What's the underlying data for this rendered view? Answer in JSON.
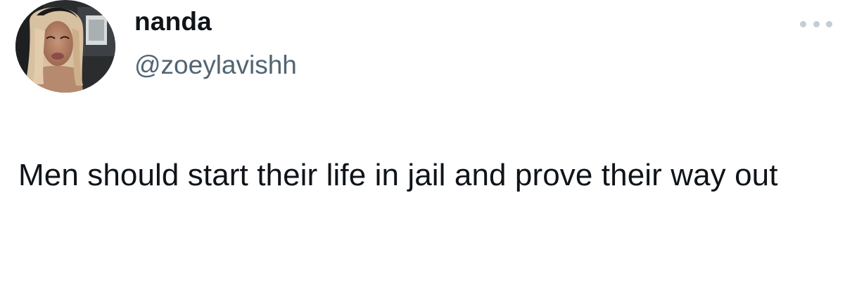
{
  "tweet": {
    "author": {
      "display_name": "nanda",
      "handle": "@zoeylavishh",
      "avatar_icon": "profile-photo"
    },
    "more_icon": "more-options-icon",
    "text": "Men should start their life in jail and prove their way out"
  },
  "colors": {
    "primary_text": "#0f1419",
    "secondary_text": "#536471",
    "more_dots": "#c4cdd4",
    "background": "#ffffff"
  }
}
